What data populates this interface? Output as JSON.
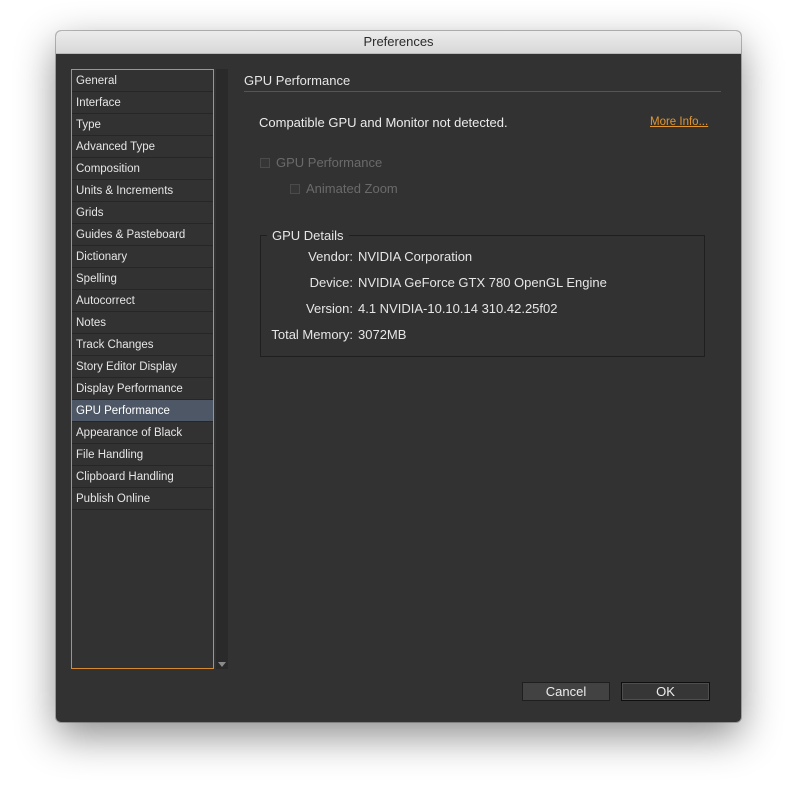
{
  "window": {
    "title": "Preferences"
  },
  "sidebar": {
    "items": [
      {
        "label": "General"
      },
      {
        "label": "Interface"
      },
      {
        "label": "Type"
      },
      {
        "label": "Advanced Type"
      },
      {
        "label": "Composition"
      },
      {
        "label": "Units & Increments"
      },
      {
        "label": "Grids"
      },
      {
        "label": "Guides & Pasteboard"
      },
      {
        "label": "Dictionary"
      },
      {
        "label": "Spelling"
      },
      {
        "label": "Autocorrect"
      },
      {
        "label": "Notes"
      },
      {
        "label": "Track Changes"
      },
      {
        "label": "Story Editor Display"
      },
      {
        "label": "Display Performance"
      },
      {
        "label": "GPU Performance"
      },
      {
        "label": "Appearance of Black"
      },
      {
        "label": "File Handling"
      },
      {
        "label": "Clipboard Handling"
      },
      {
        "label": "Publish Online"
      }
    ],
    "selected": "GPU Performance"
  },
  "main": {
    "section_title": "GPU Performance",
    "notice": "Compatible GPU and Monitor not detected.",
    "more_info": "More Info...",
    "gpu_performance_checkbox": {
      "label": "GPU Performance",
      "checked": false,
      "enabled": false
    },
    "animated_zoom_checkbox": {
      "label": "Animated Zoom",
      "checked": false,
      "enabled": false
    },
    "gpu_details": {
      "title": "GPU Details",
      "vendor_label": "Vendor:",
      "vendor": "NVIDIA Corporation",
      "device_label": "Device:",
      "device": "NVIDIA GeForce GTX 780 OpenGL Engine",
      "version_label": "Version:",
      "version": "4.1 NVIDIA-10.10.14 310.42.25f02",
      "memory_label": "Total Memory:",
      "memory": "3072MB"
    }
  },
  "buttons": {
    "cancel": "Cancel",
    "ok": "OK"
  },
  "colors": {
    "accent": "#e3952e",
    "selection": "#4d5766",
    "background": "#323232"
  }
}
